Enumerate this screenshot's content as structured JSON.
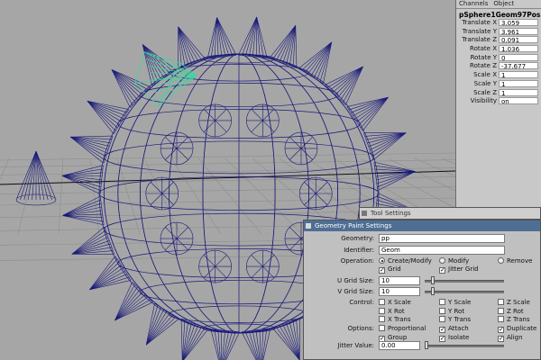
{
  "channel_box": {
    "tabs": [
      "Channels",
      "Object"
    ],
    "object_name": "pSphere1Geom97Pos",
    "attributes": [
      {
        "label": "Translate X",
        "value": "3.059"
      },
      {
        "label": "Translate Y",
        "value": "3.961"
      },
      {
        "label": "Translate Z",
        "value": "0.091"
      },
      {
        "label": "Rotate X",
        "value": "1.036"
      },
      {
        "label": "Rotate Y",
        "value": "0"
      },
      {
        "label": "Rotate Z",
        "value": "-37.677"
      },
      {
        "label": "Scale X",
        "value": "1"
      },
      {
        "label": "Scale Y",
        "value": "1"
      },
      {
        "label": "Scale Z",
        "value": "1"
      },
      {
        "label": "Visibility",
        "value": "on"
      }
    ]
  },
  "tool_settings_window": {
    "title": "Tool Settings"
  },
  "geometry_paint": {
    "title": "Geometry Paint Settings",
    "geometry_label": "Geometry:",
    "geometry_value": "pp",
    "identifier_label": "Identifier:",
    "identifier_value": "Geom",
    "operation_label": "Operation:",
    "operations": [
      {
        "label": "Create/Modify",
        "selected": true
      },
      {
        "label": "Modify",
        "selected": false
      },
      {
        "label": "Remove",
        "selected": false
      }
    ],
    "grid_label": "Grid",
    "grid_checked": true,
    "jitter_grid_label": "Jitter Grid",
    "jitter_grid_checked": true,
    "u_grid_label": "U Grid Size:",
    "u_grid_value": "10",
    "v_grid_label": "V Grid Size:",
    "v_grid_value": "10",
    "control_label": "Control:",
    "options_label": "Options:",
    "control_checks": [
      {
        "label": "X Scale",
        "checked": false
      },
      {
        "label": "Y Scale",
        "checked": false
      },
      {
        "label": "Z Scale",
        "checked": false
      },
      {
        "label": "X Rot",
        "checked": false
      },
      {
        "label": "Y Rot",
        "checked": false
      },
      {
        "label": "Z Rot",
        "checked": false
      },
      {
        "label": "X Trans",
        "checked": false
      },
      {
        "label": "Y Trans",
        "checked": false
      },
      {
        "label": "Z Trans",
        "checked": false
      }
    ],
    "option_checks": [
      {
        "label": "Proportional",
        "checked": false
      },
      {
        "label": "Attach",
        "checked": true
      },
      {
        "label": "Duplicate",
        "checked": true
      },
      {
        "label": "Group",
        "checked": true
      },
      {
        "label": "Isolate",
        "checked": true
      },
      {
        "label": "Align",
        "checked": true
      }
    ],
    "jitter_label": "Jitter Value:",
    "jitter_value": "0.00"
  },
  "colors": {
    "wireframe": "#1a1a7a",
    "selected": "#3ad8a0",
    "viewport_bg": "#a6a6a6",
    "title_bar": "#4f6e94"
  }
}
